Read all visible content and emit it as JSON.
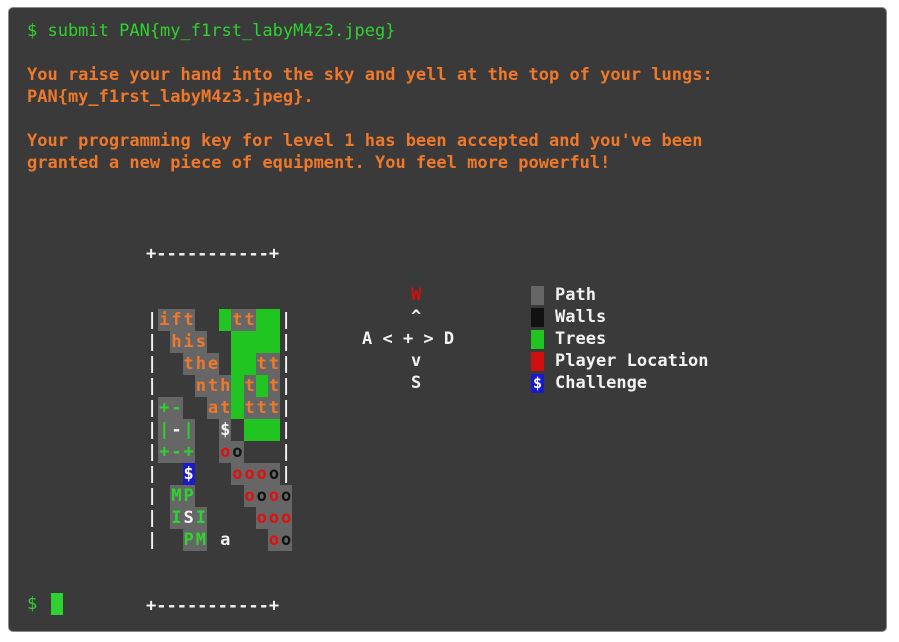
{
  "terminal": {
    "command": "$ submit PAN{my_f1rst_labyM4z3.jpeg}",
    "message_lines": [
      "You raise your hand into the sky and yell at the top of your lungs:",
      "PAN{my_f1rst_labyM4z3.jpeg}.",
      "",
      "Your programming key for level 1 has been accepted and you've been",
      "granted a new piece of equipment. You feel more powerful!"
    ],
    "prompt": "$"
  },
  "map": {
    "top_border": "+-----------+",
    "bottom_border": "+-----------+",
    "rows": [
      [
        [
          "|",
          "edge"
        ],
        [
          "i",
          "path tOr"
        ],
        [
          "f",
          "path tOr"
        ],
        [
          "t",
          "path tOr"
        ],
        [
          " ",
          ""
        ],
        [
          " ",
          ""
        ],
        [
          "",
          "tree"
        ],
        [
          "t",
          "path tOr"
        ],
        [
          "t",
          "path tOr"
        ],
        [
          "",
          "tree"
        ],
        [
          "",
          "tree"
        ],
        [
          "|",
          "edge"
        ]
      ],
      [
        [
          "|",
          "edge"
        ],
        [
          " ",
          ""
        ],
        [
          "h",
          "path tOr"
        ],
        [
          "i",
          "path tOr"
        ],
        [
          "s",
          "path tOr"
        ],
        [
          " ",
          ""
        ],
        [
          " ",
          ""
        ],
        [
          "",
          "tree"
        ],
        [
          "",
          "tree"
        ],
        [
          "",
          "tree"
        ],
        [
          "",
          "tree"
        ],
        [
          "|",
          "edge"
        ]
      ],
      [
        [
          "|",
          "edge"
        ],
        [
          " ",
          ""
        ],
        [
          " ",
          ""
        ],
        [
          "t",
          "path tOr"
        ],
        [
          "h",
          "path tOr"
        ],
        [
          "e",
          "path tOr"
        ],
        [
          " ",
          ""
        ],
        [
          "",
          "tree"
        ],
        [
          "",
          "tree"
        ],
        [
          "t",
          "path tOr"
        ],
        [
          "t",
          "path tOr"
        ],
        [
          "|",
          "edge"
        ]
      ],
      [
        [
          "|",
          "edge"
        ],
        [
          " ",
          ""
        ],
        [
          " ",
          ""
        ],
        [
          " ",
          ""
        ],
        [
          "n",
          "path tOr"
        ],
        [
          "t",
          "path tOr"
        ],
        [
          "h",
          "path tOr"
        ],
        [
          "",
          "tree"
        ],
        [
          "t",
          "path tOr"
        ],
        [
          "",
          "tree"
        ],
        [
          "t",
          "path tOr"
        ],
        [
          "|",
          "edge"
        ]
      ],
      [
        [
          "|",
          "edge"
        ],
        [
          "+",
          "path tGr"
        ],
        [
          "-",
          "path tGr"
        ],
        [
          " ",
          ""
        ],
        [
          " ",
          ""
        ],
        [
          "a",
          "path tOr"
        ],
        [
          "t",
          "path tOr"
        ],
        [
          "",
          "tree"
        ],
        [
          "t",
          "path tOr"
        ],
        [
          "t",
          "path tOr"
        ],
        [
          "t",
          "path tOr"
        ],
        [
          "|",
          "edge"
        ]
      ],
      [
        [
          "|",
          "edge"
        ],
        [
          "|",
          "path tGr"
        ],
        [
          "-",
          "path tWh"
        ],
        [
          "|",
          "path tGr"
        ],
        [
          " ",
          ""
        ],
        [
          " ",
          ""
        ],
        [
          "$",
          "path tWh"
        ],
        [
          " ",
          ""
        ],
        [
          "",
          "tree"
        ],
        [
          "",
          "tree"
        ],
        [
          "",
          "tree"
        ],
        [
          "|",
          "edge"
        ]
      ],
      [
        [
          "|",
          "edge"
        ],
        [
          "+",
          "path tGr"
        ],
        [
          "-",
          "path tGr"
        ],
        [
          "+",
          "path tGr"
        ],
        [
          " ",
          ""
        ],
        [
          " ",
          ""
        ],
        [
          "o",
          "path tRed"
        ],
        [
          "o",
          "path tBlk"
        ],
        [
          " ",
          ""
        ],
        [
          " ",
          ""
        ],
        [
          " ",
          ""
        ],
        [
          "|",
          "edge"
        ]
      ],
      [
        [
          "|",
          "edge"
        ],
        [
          " ",
          ""
        ],
        [
          " ",
          ""
        ],
        [
          "$",
          "chal"
        ],
        [
          " ",
          ""
        ],
        [
          " ",
          ""
        ],
        [
          " ",
          ""
        ],
        [
          "o",
          "path tRed"
        ],
        [
          "o",
          "path tRed"
        ],
        [
          "o",
          "path tRed"
        ],
        [
          "o",
          "path tBlk"
        ],
        [
          "|",
          "edge"
        ]
      ],
      [
        [
          "|",
          "edge"
        ],
        [
          " ",
          ""
        ],
        [
          "M",
          "path tGr"
        ],
        [
          "P",
          "path tGr"
        ],
        [
          " ",
          ""
        ],
        [
          " ",
          ""
        ],
        [
          " ",
          ""
        ],
        [
          " ",
          ""
        ],
        [
          "o",
          "path tRed"
        ],
        [
          "o",
          "path tBlk"
        ],
        [
          "o",
          "path tRed"
        ],
        [
          "o",
          "path tBlk"
        ]
      ],
      [
        [
          "|",
          "edge"
        ],
        [
          " ",
          ""
        ],
        [
          "I",
          "path tGr"
        ],
        [
          "S",
          "path tWh"
        ],
        [
          "I",
          "path tGr"
        ],
        [
          " ",
          ""
        ],
        [
          " ",
          ""
        ],
        [
          " ",
          ""
        ],
        [
          " ",
          ""
        ],
        [
          "o",
          "path tRed"
        ],
        [
          "o",
          "path tRed"
        ],
        [
          "o",
          "path tRed"
        ]
      ],
      [
        [
          "|",
          "edge"
        ],
        [
          " ",
          ""
        ],
        [
          " ",
          ""
        ],
        [
          "P",
          "path tGr"
        ],
        [
          "M",
          "path tGr"
        ],
        [
          " ",
          ""
        ],
        [
          "a",
          "tWh"
        ],
        [
          " ",
          ""
        ],
        [
          " ",
          ""
        ],
        [
          " ",
          ""
        ],
        [
          "o",
          "path tRed"
        ],
        [
          "o",
          "path tBlk"
        ]
      ]
    ]
  },
  "controls": {
    "up_key": "W",
    "up_arrow": "^",
    "middle": "A < + > D",
    "down_arrow": "v",
    "down_key": "S"
  },
  "legend": [
    {
      "label": "Path",
      "color": "#666666"
    },
    {
      "label": "Walls",
      "color": "#111111"
    },
    {
      "label": "Trees",
      "color": "#21c521"
    },
    {
      "label": "Player Location",
      "color": "#d01010"
    },
    {
      "label": "Challenge",
      "color": "#1a1acc",
      "glyph": "$"
    }
  ]
}
